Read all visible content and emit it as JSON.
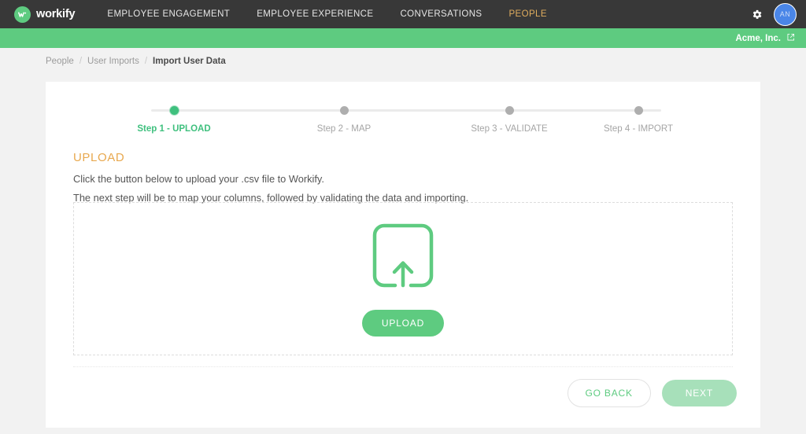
{
  "header": {
    "brand_name": "workify",
    "brand_icon": "workify-w-mark-icon",
    "nav": [
      {
        "label": "EMPLOYEE ENGAGEMENT",
        "active": false
      },
      {
        "label": "EMPLOYEE EXPERIENCE",
        "active": false
      },
      {
        "label": "CONVERSATIONS",
        "active": false
      },
      {
        "label": "PEOPLE",
        "active": true
      }
    ],
    "settings_icon": "gear-icon",
    "avatar_initials": "AN",
    "accent_active": "#e0ad5e",
    "bar_color": "#383838"
  },
  "orgbar": {
    "org_name": "Acme, Inc.",
    "external_icon": "external-link-icon",
    "color": "#5ecb80"
  },
  "breadcrumb": {
    "separator": "/",
    "items": [
      {
        "label": "People",
        "current": false
      },
      {
        "label": "User Imports",
        "current": false
      },
      {
        "label": "Import User Data",
        "current": true
      }
    ]
  },
  "stepper": {
    "steps": [
      {
        "label": "Step 1 - UPLOAD",
        "active": true
      },
      {
        "label": "Step 2 - MAP",
        "active": false
      },
      {
        "label": "Step 3 - VALIDATE",
        "active": false
      },
      {
        "label": "Step 4 - IMPORT",
        "active": false
      }
    ],
    "active_color": "#3fc07e",
    "inactive_color": "#aeaeae"
  },
  "main": {
    "section_title": "UPLOAD",
    "section_title_color": "#e8a84e",
    "line1": "Click the button below to upload your .csv file to Workify.",
    "line2": "The next step will be to map your columns, followed by validating the data and importing.",
    "dropzone": {
      "icon": "upload-tray-arrow-icon",
      "icon_color": "#5ecb80",
      "upload_label": "UPLOAD"
    }
  },
  "footer": {
    "go_back_label": "GO BACK",
    "next_label": "NEXT",
    "next_disabled": true
  }
}
